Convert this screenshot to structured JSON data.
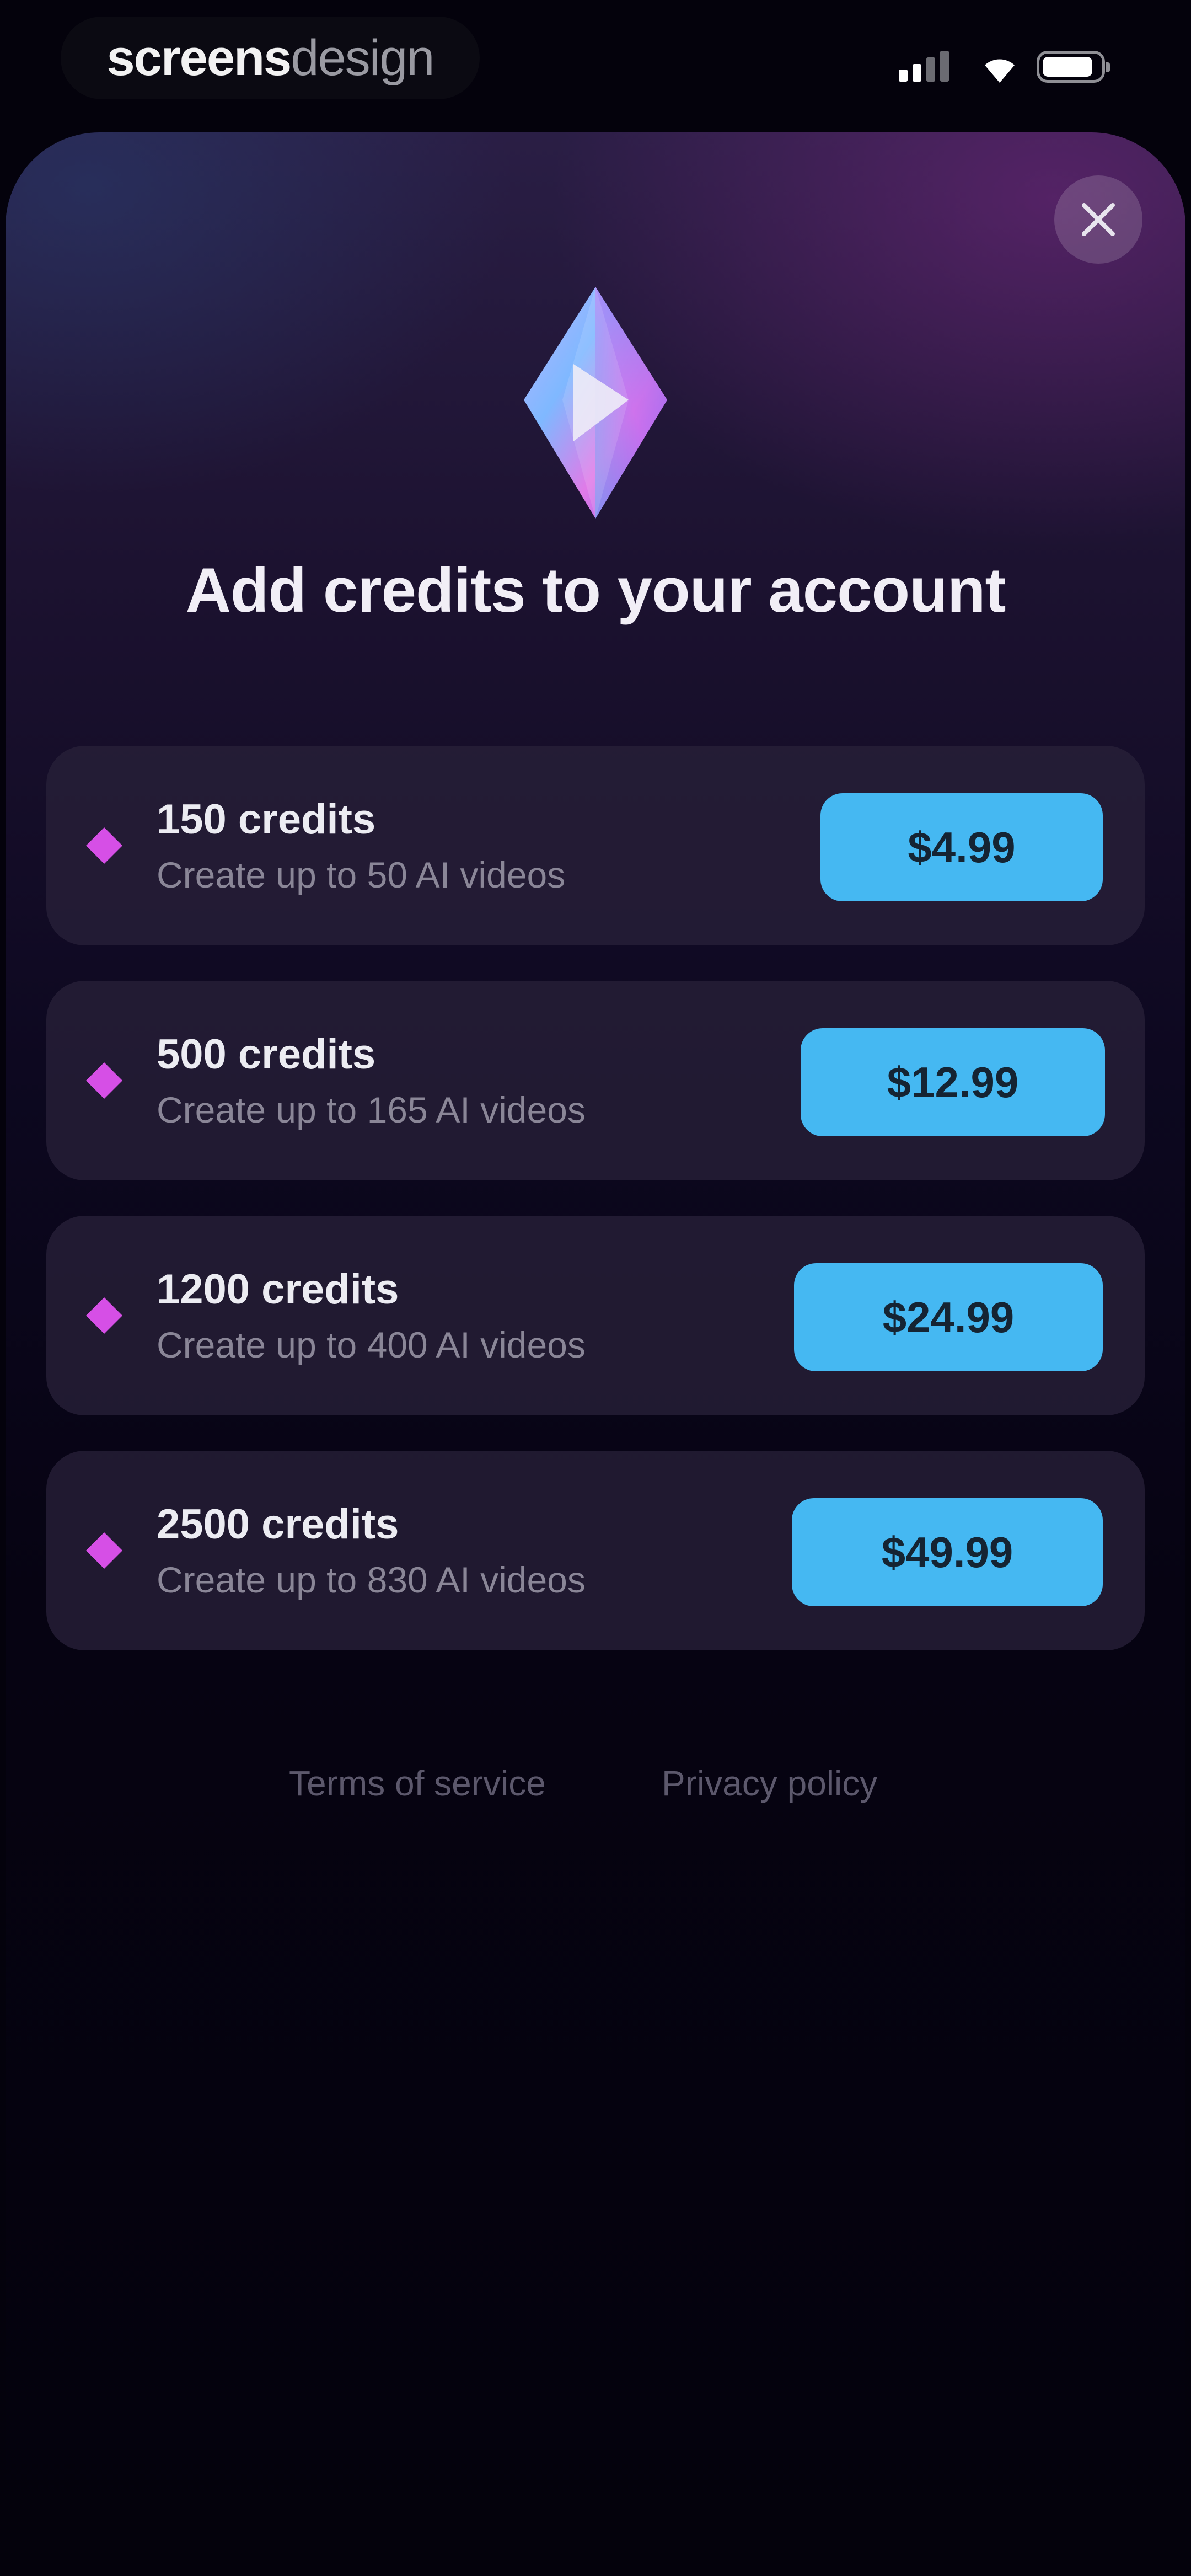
{
  "status_bar": {
    "brand_bold": "screens",
    "brand_light": "design"
  },
  "sheet": {
    "title": "Add credits to your account",
    "packages": [
      {
        "credits": "150 credits",
        "description": "Create up to 50 AI videos",
        "price": "$4.99"
      },
      {
        "credits": "500 credits",
        "description": "Create up to 165 AI videos",
        "price": "$12.99"
      },
      {
        "credits": "1200 credits",
        "description": "Create up to 400 AI videos",
        "price": "$24.99"
      },
      {
        "credits": "2500 credits",
        "description": "Create up to 830 AI videos",
        "price": "$49.99"
      }
    ],
    "footer": {
      "terms": "Terms of service",
      "privacy": "Privacy policy"
    }
  },
  "colors": {
    "accent": "#45b8f2",
    "diamond": "#d64fe6",
    "card": "#282038",
    "background": "#04020c"
  },
  "icons": {
    "close": "close-icon",
    "gem": "gem-icon",
    "diamond": "diamond-icon"
  }
}
